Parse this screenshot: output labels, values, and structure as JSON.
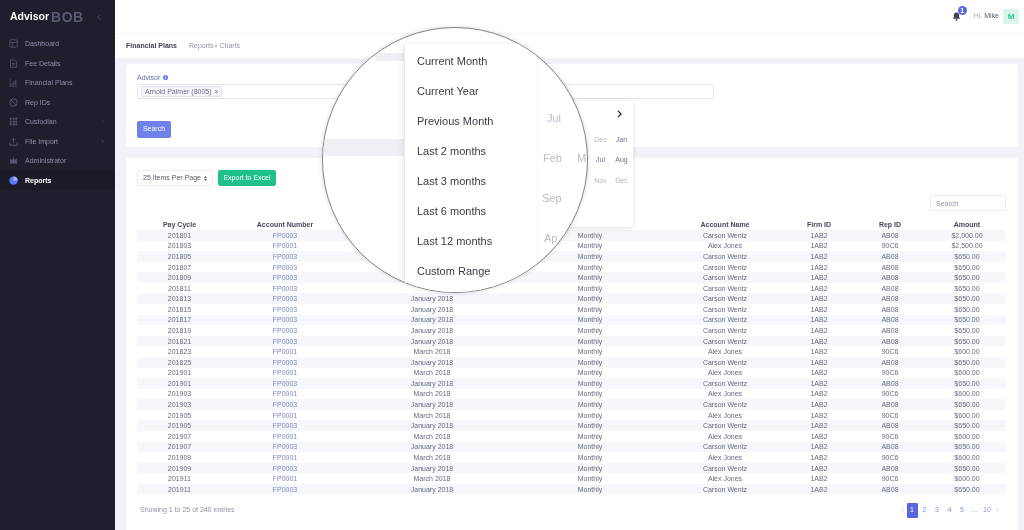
{
  "sidebar": {
    "logo": {
      "text": "Advisor",
      "mark": "BOB"
    },
    "items": [
      {
        "label": "Dashboard",
        "selected": false,
        "submenu": false
      },
      {
        "label": "Fee Details",
        "selected": false,
        "submenu": false
      },
      {
        "label": "Financial Plans",
        "selected": false,
        "submenu": false
      },
      {
        "label": "Rep IDs",
        "selected": false,
        "submenu": false
      },
      {
        "label": "Custodian",
        "selected": false,
        "submenu": true
      },
      {
        "label": "File Import",
        "selected": false,
        "submenu": true
      },
      {
        "label": "Administrator",
        "selected": false,
        "submenu": false
      },
      {
        "label": "Reports",
        "selected": true,
        "submenu": false
      }
    ]
  },
  "topbar": {
    "notification_count": "1",
    "greeting": "Hi,",
    "user_name": "Mike",
    "avatar": "M"
  },
  "subheader": {
    "title": "Financial Plans",
    "breadcrumb": [
      "Reports",
      "Charts"
    ]
  },
  "filter": {
    "label": "Advisor",
    "tags": [
      {
        "label": "Arnold Palmer (8005)",
        "remove": "×"
      }
    ],
    "button": "Search"
  },
  "month_picker": {
    "months": [
      {
        "label": "Dec",
        "disabled": true
      },
      {
        "label": "Jan",
        "disabled": false
      },
      {
        "label": "Jul",
        "disabled": false
      },
      {
        "label": "Aug",
        "disabled": false
      },
      {
        "label": "Nov",
        "disabled": true
      },
      {
        "label": "Dec",
        "disabled": true
      }
    ]
  },
  "zoom_lens": {
    "ranges": [
      "Current Month",
      "Current Year",
      "Previous Month",
      "Last 2 months",
      "Last 3 months",
      "Last 6 months",
      "Last 12 months",
      "Custom Range"
    ],
    "months": [
      "Jul",
      "Feb",
      "M",
      "Sep",
      "Ap"
    ]
  },
  "table_toolbar": {
    "page_size": "25 Items Per Page",
    "export_button": "Export to Excel",
    "search": {
      "placeholder": "Search"
    }
  },
  "table": {
    "columns": [
      "Pay Cycle",
      "Account Number",
      null,
      null,
      "Account Name",
      "Firm ID",
      "Rep ID",
      "Amount"
    ],
    "rows": [
      [
        "201801",
        "FP0003",
        null,
        "Monthly",
        "Carson Wentz",
        "1AB2",
        "AB08",
        "$2,000.00"
      ],
      [
        "201803",
        "FP0001",
        null,
        "Monthly",
        "Alex Jones",
        "1AB2",
        "90C6",
        "$2,500.00"
      ],
      [
        "201805",
        "FP0003",
        null,
        "Monthly",
        "Carson Wentz",
        "1AB2",
        "AB08",
        "$650.00"
      ],
      [
        "201807",
        "FP0003",
        null,
        "Monthly",
        "Carson Wentz",
        "1AB2",
        "AB08",
        "$650.00"
      ],
      [
        "201809",
        "FP0003",
        null,
        "Monthly",
        "Carson Wentz",
        "1AB2",
        "AB08",
        "$650.00"
      ],
      [
        "201811",
        "FP0003",
        null,
        "Monthly",
        "Carson Wentz",
        "1AB2",
        "AB08",
        "$650.00"
      ],
      [
        "201813",
        "FP0003",
        "January 2018",
        "Monthly",
        "Carson Wentz",
        "1AB2",
        "AB08",
        "$650.00"
      ],
      [
        "201815",
        "FP0003",
        "January 2018",
        "Monthly",
        "Carson Wentz",
        "1AB2",
        "AB08",
        "$650.00"
      ],
      [
        "201817",
        "FP0003",
        "January 2018",
        "Monthly",
        "Carson Wentz",
        "1AB2",
        "AB08",
        "$650.00"
      ],
      [
        "201819",
        "FP0003",
        "January 2018",
        "Monthly",
        "Carson Wentz",
        "1AB2",
        "AB08",
        "$650.00"
      ],
      [
        "201821",
        "FP0003",
        "January 2018",
        "Monthly",
        "Carson Wentz",
        "1AB2",
        "AB08",
        "$650.00"
      ],
      [
        "201823",
        "FP0001",
        "March 2018",
        "Monthly",
        "Alex Jones",
        "1AB2",
        "90C6",
        "$600.00"
      ],
      [
        "201825",
        "FP0003",
        "January 2018",
        "Monthly",
        "Carson Wentz",
        "1AB2",
        "AB08",
        "$650.00"
      ],
      [
        "201901",
        "FP0001",
        "March 2018",
        "Monthly",
        "Alex Jones",
        "1AB2",
        "90C6",
        "$600.00"
      ],
      [
        "201901",
        "FP0003",
        "January 2018",
        "Monthly",
        "Carson Wentz",
        "1AB2",
        "AB08",
        "$650.00"
      ],
      [
        "201903",
        "FP0001",
        "March 2018",
        "Monthly",
        "Alex Jones",
        "1AB2",
        "90C6",
        "$600.00"
      ],
      [
        "201903",
        "FP0003",
        "January 2018",
        "Monthly",
        "Carson Wentz",
        "1AB2",
        "AB08",
        "$650.00"
      ],
      [
        "201905",
        "FP0001",
        "March 2018",
        "Monthly",
        "Alex Jones",
        "1AB2",
        "90C6",
        "$600.00"
      ],
      [
        "201905",
        "FP0003",
        "January 2018",
        "Monthly",
        "Carson Wentz",
        "1AB2",
        "AB08",
        "$650.00"
      ],
      [
        "201907",
        "FP0001",
        "March 2018",
        "Monthly",
        "Alex Jones",
        "1AB2",
        "90C6",
        "$600.00"
      ],
      [
        "201907",
        "FP0003",
        "January 2018",
        "Monthly",
        "Carson Wentz",
        "1AB2",
        "AB08",
        "$650.00"
      ],
      [
        "201909",
        "FP0001",
        "March 2018",
        "Monthly",
        "Alex Jones",
        "1AB2",
        "90C6",
        "$600.00"
      ],
      [
        "201909",
        "FP0003",
        "January 2018",
        "Monthly",
        "Carson Wentz",
        "1AB2",
        "AB08",
        "$650.00"
      ],
      [
        "201911",
        "FP0001",
        "March 2018",
        "Monthly",
        "Alex Jones",
        "1AB2",
        "90C6",
        "$600.00"
      ],
      [
        "201911",
        "FP0003",
        "January 2018",
        "Monthly",
        "Carson Wentz",
        "1AB2",
        "AB08",
        "$650.00"
      ]
    ]
  },
  "footer": {
    "info": "Showing 1 to 25 of 240 entries",
    "pages": [
      {
        "label": "1",
        "selected": true
      },
      {
        "label": "2",
        "selected": false
      },
      {
        "label": "3",
        "selected": false
      },
      {
        "label": "4",
        "selected": false
      },
      {
        "label": "5",
        "selected": false
      },
      {
        "label": "…",
        "selected": false
      },
      {
        "label": "10",
        "selected": false
      }
    ]
  }
}
